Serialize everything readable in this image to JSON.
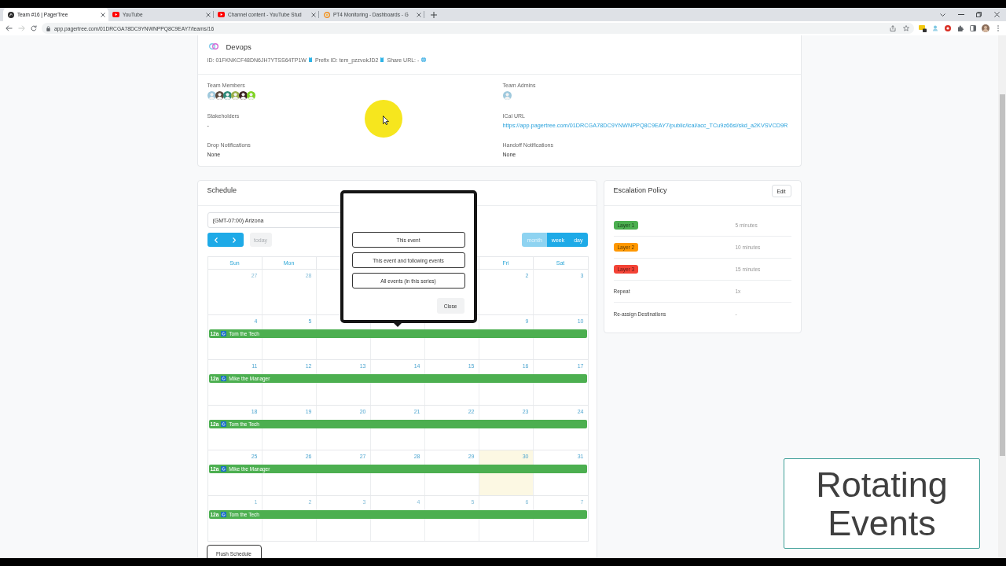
{
  "browser": {
    "tabs": [
      {
        "title": "Team #16 | PagerTree",
        "kind": "app",
        "selected": true
      },
      {
        "title": "YouTube",
        "kind": "video",
        "selected": false
      },
      {
        "title": "Channel content - YouTube Stud",
        "kind": "video",
        "selected": false
      },
      {
        "title": "PT4 Monitoring - Dashboards - G",
        "kind": "dashboard",
        "selected": false
      }
    ],
    "url": "app.pagertree.com/01DRCGA78DC9YNWNPPQ8C9EAY7/teams/16"
  },
  "team": {
    "name": "Devops",
    "meta": [
      {
        "text": "ID: 01FKNKCF48DN6JH7YTSS64TP1W",
        "kind": "copy"
      },
      {
        "text": "Prefix ID: tem_pzzvokJD2",
        "kind": "copy"
      },
      {
        "text": "Share URL: -",
        "kind": "globe"
      }
    ],
    "fields": [
      {
        "label": "Team Members",
        "kind": "avatars",
        "avatars": [
          {
            "color": "#9fc9dd"
          },
          {
            "color": "#5b4a3f"
          },
          {
            "color": "#2e8b7a"
          },
          {
            "color": "#9bb04a"
          },
          {
            "color": "#3b2323"
          },
          {
            "color": "#7ed321"
          }
        ]
      },
      {
        "label": "Team Admins",
        "kind": "avatars",
        "avatars": [
          {
            "color": "#9fc9dd"
          }
        ]
      },
      {
        "label": "Stakeholders",
        "kind": "text",
        "value": "-"
      },
      {
        "label": "ICal URL",
        "kind": "link",
        "value": "https://app.pagertree.com/01DRCGA78DC9YNWNPPQ8C9EAY7/public/ical/acc_TCu9z66sl/skd_a2KVSVCD9R"
      },
      {
        "label": "Drop Notifications",
        "kind": "text",
        "value": "None"
      },
      {
        "label": "Handoff Notifications",
        "kind": "text",
        "value": "None"
      }
    ]
  },
  "schedule": {
    "title": "Schedule",
    "timezone": "(GMT-07:00) Arizona",
    "today_button": {
      "label": "today",
      "disabled": true
    },
    "views": [
      {
        "label": "month",
        "selected": true
      },
      {
        "label": "week",
        "selected": false
      },
      {
        "label": "day",
        "selected": false
      }
    ],
    "weekdays_start": [
      "Sun",
      "Mon"
    ],
    "weekdays_end": [
      "Fri",
      "Sat"
    ],
    "weeks": [
      {
        "days_start": [
          {
            "label": "27",
            "other_month": true,
            "today": false
          },
          {
            "label": "28",
            "other_month": true,
            "today": false
          }
        ],
        "days_end": [
          {
            "label": "2",
            "other_month": false,
            "today": false
          },
          {
            "label": "3",
            "other_month": false,
            "today": false
          }
        ]
      },
      {
        "days_start": [
          {
            "label": "4",
            "other_month": false,
            "today": false
          },
          {
            "label": "5",
            "other_month": false,
            "today": false
          }
        ],
        "days_end": [
          {
            "label": "9",
            "other_month": false,
            "today": false
          },
          {
            "label": "10",
            "other_month": false,
            "today": false
          }
        ],
        "event": {
          "time": "12a",
          "name": "Tom the Tech"
        }
      },
      {
        "days": [
          {
            "label": "11",
            "other_month": false,
            "today": false
          },
          {
            "label": "12",
            "other_month": false,
            "today": false
          },
          {
            "label": "13",
            "other_month": false,
            "today": false
          },
          {
            "label": "14",
            "other_month": false,
            "today": false
          },
          {
            "label": "15",
            "other_month": false,
            "today": false
          },
          {
            "label": "16",
            "other_month": false,
            "today": false
          },
          {
            "label": "17",
            "other_month": false,
            "today": false
          }
        ],
        "event": {
          "time": "12a",
          "name": "Mike the Manager"
        }
      },
      {
        "days": [
          {
            "label": "18",
            "other_month": false,
            "today": false
          },
          {
            "label": "19",
            "other_month": false,
            "today": false
          },
          {
            "label": "20",
            "other_month": false,
            "today": false
          },
          {
            "label": "21",
            "other_month": false,
            "today": false
          },
          {
            "label": "22",
            "other_month": false,
            "today": false
          },
          {
            "label": "23",
            "other_month": false,
            "today": false
          },
          {
            "label": "24",
            "other_month": false,
            "today": false
          }
        ],
        "event": {
          "time": "12a",
          "name": "Tom the Tech"
        }
      },
      {
        "days": [
          {
            "label": "25",
            "other_month": false,
            "today": false
          },
          {
            "label": "26",
            "other_month": false,
            "today": false
          },
          {
            "label": "27",
            "other_month": false,
            "today": false
          },
          {
            "label": "28",
            "other_month": false,
            "today": false
          },
          {
            "label": "29",
            "other_month": false,
            "today": false
          },
          {
            "label": "30",
            "other_month": false,
            "today": true
          },
          {
            "label": "31",
            "other_month": false,
            "today": false
          }
        ],
        "event": {
          "time": "12a",
          "name": "Mike the Manager"
        }
      },
      {
        "days": [
          {
            "label": "1",
            "other_month": true,
            "today": false
          },
          {
            "label": "2",
            "other_month": true,
            "today": false
          },
          {
            "label": "3",
            "other_month": true,
            "today": false
          },
          {
            "label": "4",
            "other_month": true,
            "today": false
          },
          {
            "label": "5",
            "other_month": true,
            "today": false
          },
          {
            "label": "6",
            "other_month": true,
            "today": false
          },
          {
            "label": "7",
            "other_month": true,
            "today": false
          }
        ],
        "event": {
          "time": "12a",
          "name": "Tom the Tech"
        }
      }
    ],
    "flush_button": "Flush Schedule"
  },
  "popover": {
    "options": [
      "This event",
      "This event and following events",
      "All events (in this series)"
    ],
    "close_button": "Close"
  },
  "escalation_policy": {
    "title": "Escalation Policy",
    "edit_button": "Edit",
    "rows": [
      {
        "kind": "layer",
        "label": "Layer 1",
        "color": "#4caf50",
        "value": "5 minutes"
      },
      {
        "kind": "layer",
        "label": "Layer 2",
        "color": "#ff9800",
        "value": "10 minutes"
      },
      {
        "kind": "layer",
        "label": "Layer 3",
        "color": "#f44336",
        "value": "15 minutes"
      },
      {
        "kind": "plain",
        "label": "Repeat",
        "value": "1x"
      },
      {
        "kind": "plain",
        "label": "Re-assign Destinations",
        "value": "-"
      }
    ]
  },
  "caption": {
    "text": "Rotating Events"
  }
}
